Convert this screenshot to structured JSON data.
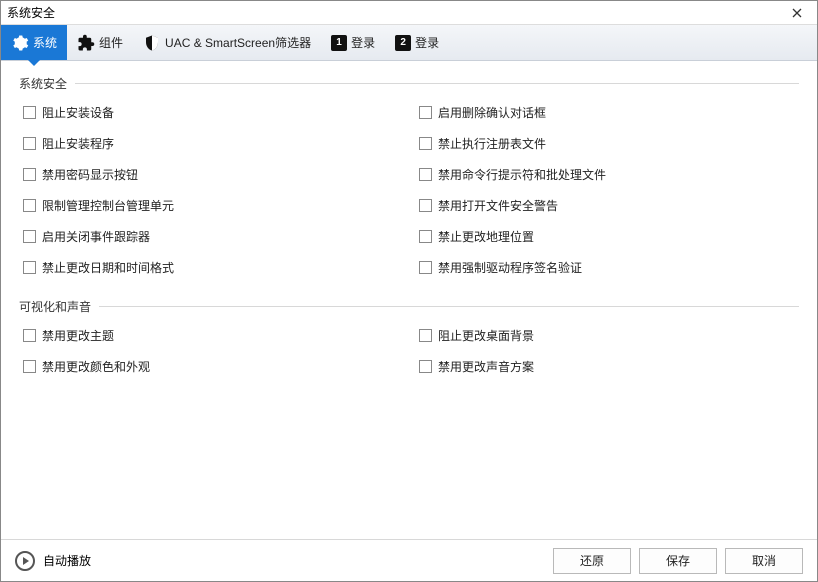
{
  "window": {
    "title": "系统安全"
  },
  "tabs": [
    {
      "label": "系统"
    },
    {
      "label": "组件"
    },
    {
      "label": "UAC & SmartScreen筛选器"
    },
    {
      "label": "登录",
      "badge": "1"
    },
    {
      "label": "登录",
      "badge": "2"
    }
  ],
  "groups": [
    {
      "title": "系统安全",
      "options_left": [
        "阻止安装设备",
        "阻止安装程序",
        "禁用密码显示按钮",
        "限制管理控制台管理单元",
        "启用关闭事件跟踪器",
        "禁止更改日期和时间格式"
      ],
      "options_right": [
        "启用删除确认对话框",
        "禁止执行注册表文件",
        "禁用命令行提示符和批处理文件",
        "禁用打开文件安全警告",
        "禁止更改地理位置",
        "禁用强制驱动程序签名验证"
      ]
    },
    {
      "title": "可视化和声音",
      "options_left": [
        "禁用更改主题",
        "禁用更改颜色和外观"
      ],
      "options_right": [
        "阻止更改桌面背景",
        "禁用更改声音方案"
      ]
    }
  ],
  "footer": {
    "autoplay": "自动播放",
    "restore": "还原",
    "save": "保存",
    "cancel": "取消"
  }
}
